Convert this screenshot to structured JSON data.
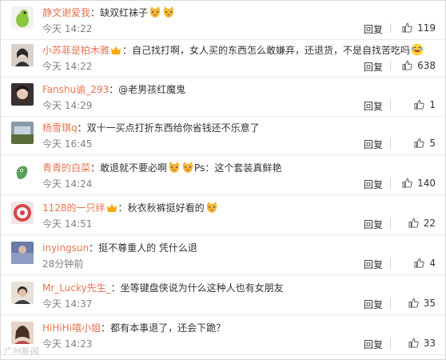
{
  "reply_label": "回复",
  "comments": [
    {
      "user": "静文谢爱我",
      "vip": false,
      "text": "缺双红袜子",
      "emoji_after": 2,
      "time": "今天 14:22",
      "likes": "119"
    },
    {
      "user": "小苏菲是柏木雅",
      "vip": true,
      "text": "自己找打啊，女人买的东西怎么敢嫌弃，还退货，不是自找苦吃吗",
      "emoji_after": 1,
      "time": "今天 14:22",
      "likes": "638"
    },
    {
      "user": "Fanshu谕_293",
      "vip": false,
      "text": "@老男孩红魔鬼",
      "emoji_after": 0,
      "time": "今天 14:29",
      "likes": "1"
    },
    {
      "user": "杨雪琪q",
      "vip": false,
      "text": "双十一买点打折东西给你省钱还不乐意了",
      "emoji_after": 0,
      "time": "今天 16:45",
      "likes": "5"
    },
    {
      "user": "青青的白菜",
      "vip": false,
      "text": "敢退就不要必啊",
      "emoji_after": 2,
      "text2": "Ps：这个套装真鲜艳",
      "time": "今天 14:24",
      "likes": "140"
    },
    {
      "user": "1128的一只绊",
      "vip": true,
      "text": "秋衣秋裤挺好看的",
      "emoji_after": 1,
      "time": "今天 14:51",
      "likes": "22"
    },
    {
      "user": "inyingsun",
      "vip": false,
      "text": "挺不尊重人的 凭什么退",
      "emoji_after": 0,
      "time": "28分钟前",
      "likes": "4"
    },
    {
      "user": "Mr_Lucky先生_",
      "vip": false,
      "text": "坐等键盘侠说为什么这种人也有女朋友",
      "emoji_after": 0,
      "time": "今天 14:37",
      "likes": "35"
    },
    {
      "user": "HiHiHi嘻小姐",
      "vip": false,
      "text": "都有本事退了，还会下跪？",
      "emoji_after": 0,
      "time": "今天 14:23",
      "likes": "33"
    }
  ],
  "watermark": "广州新闻",
  "colors": {
    "username": "#eb7350",
    "time": "#808080",
    "border": "#eaeaea"
  }
}
